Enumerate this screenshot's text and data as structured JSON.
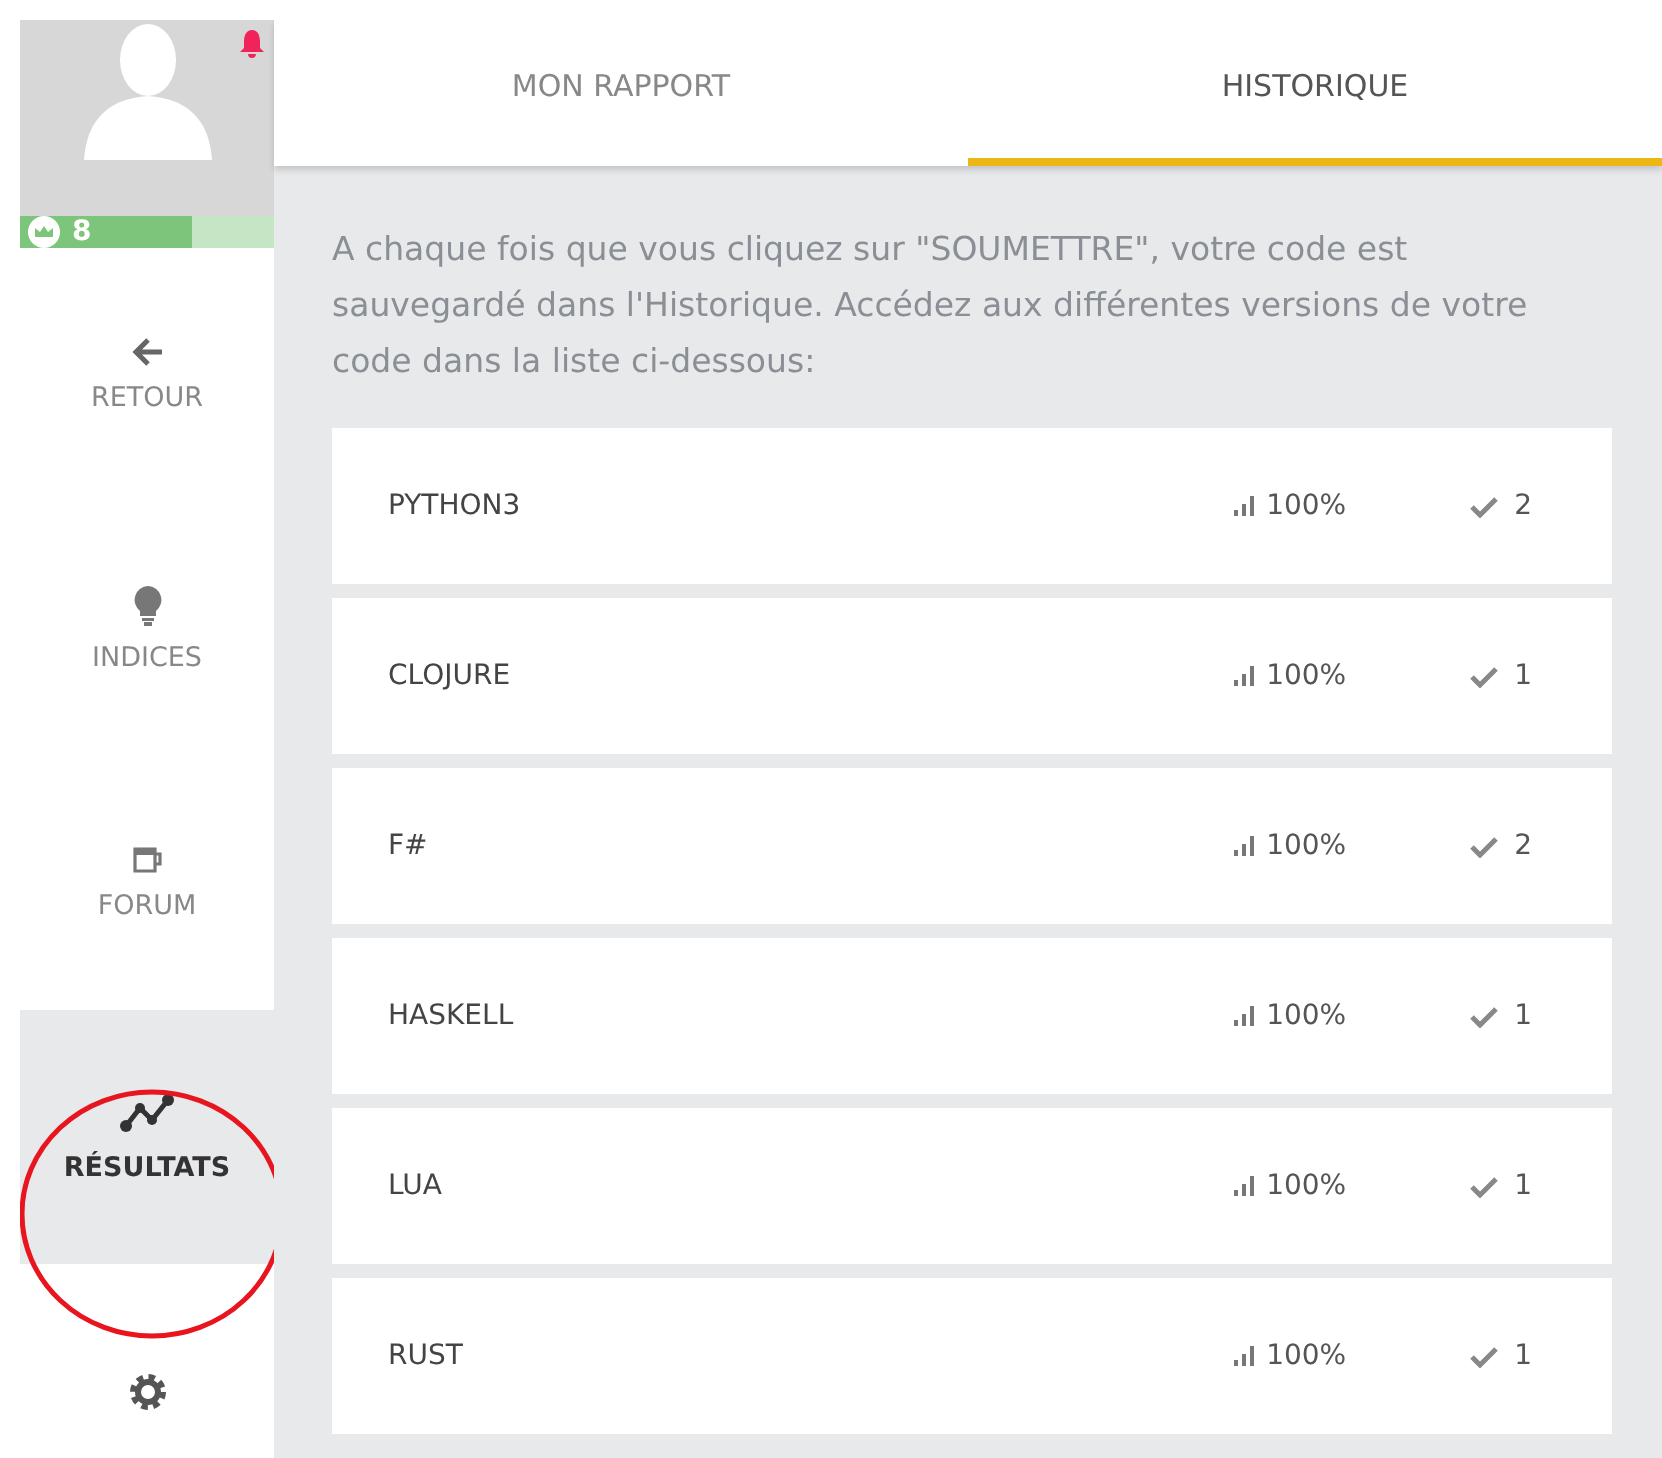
{
  "profile": {
    "notification": true,
    "score": "8",
    "level": 0.68
  },
  "sidebar": {
    "items": [
      {
        "label": "RETOUR",
        "selected": false
      },
      {
        "label": "INDICES",
        "selected": false
      },
      {
        "label": "FORUM",
        "selected": false
      },
      {
        "label": "RÉSULTATS",
        "selected": true,
        "circled": true
      },
      {
        "selected": false
      }
    ]
  },
  "tabs": [
    {
      "label": "MON RAPPORT",
      "selected": false
    },
    {
      "label": "HISTORIQUE",
      "selected": true
    }
  ],
  "intro": "A chaque fois que vous cliquez sur \"SOUMETTRE\", votre code est sauvegardé dans l'Historique. Accédez aux différentes versions de votre code dans la liste ci-dessous:",
  "history": [
    {
      "language": "PYTHON3",
      "score": "100%",
      "passed": "2"
    },
    {
      "language": "CLOJURE",
      "score": "100%",
      "passed": "1"
    },
    {
      "language": "F#",
      "score": "100%",
      "passed": "2"
    },
    {
      "language": "HASKELL",
      "score": "100%",
      "passed": "1"
    },
    {
      "language": "LUA",
      "score": "100%",
      "passed": "1"
    },
    {
      "language": "RUST",
      "score": "100%",
      "passed": "1"
    }
  ]
}
